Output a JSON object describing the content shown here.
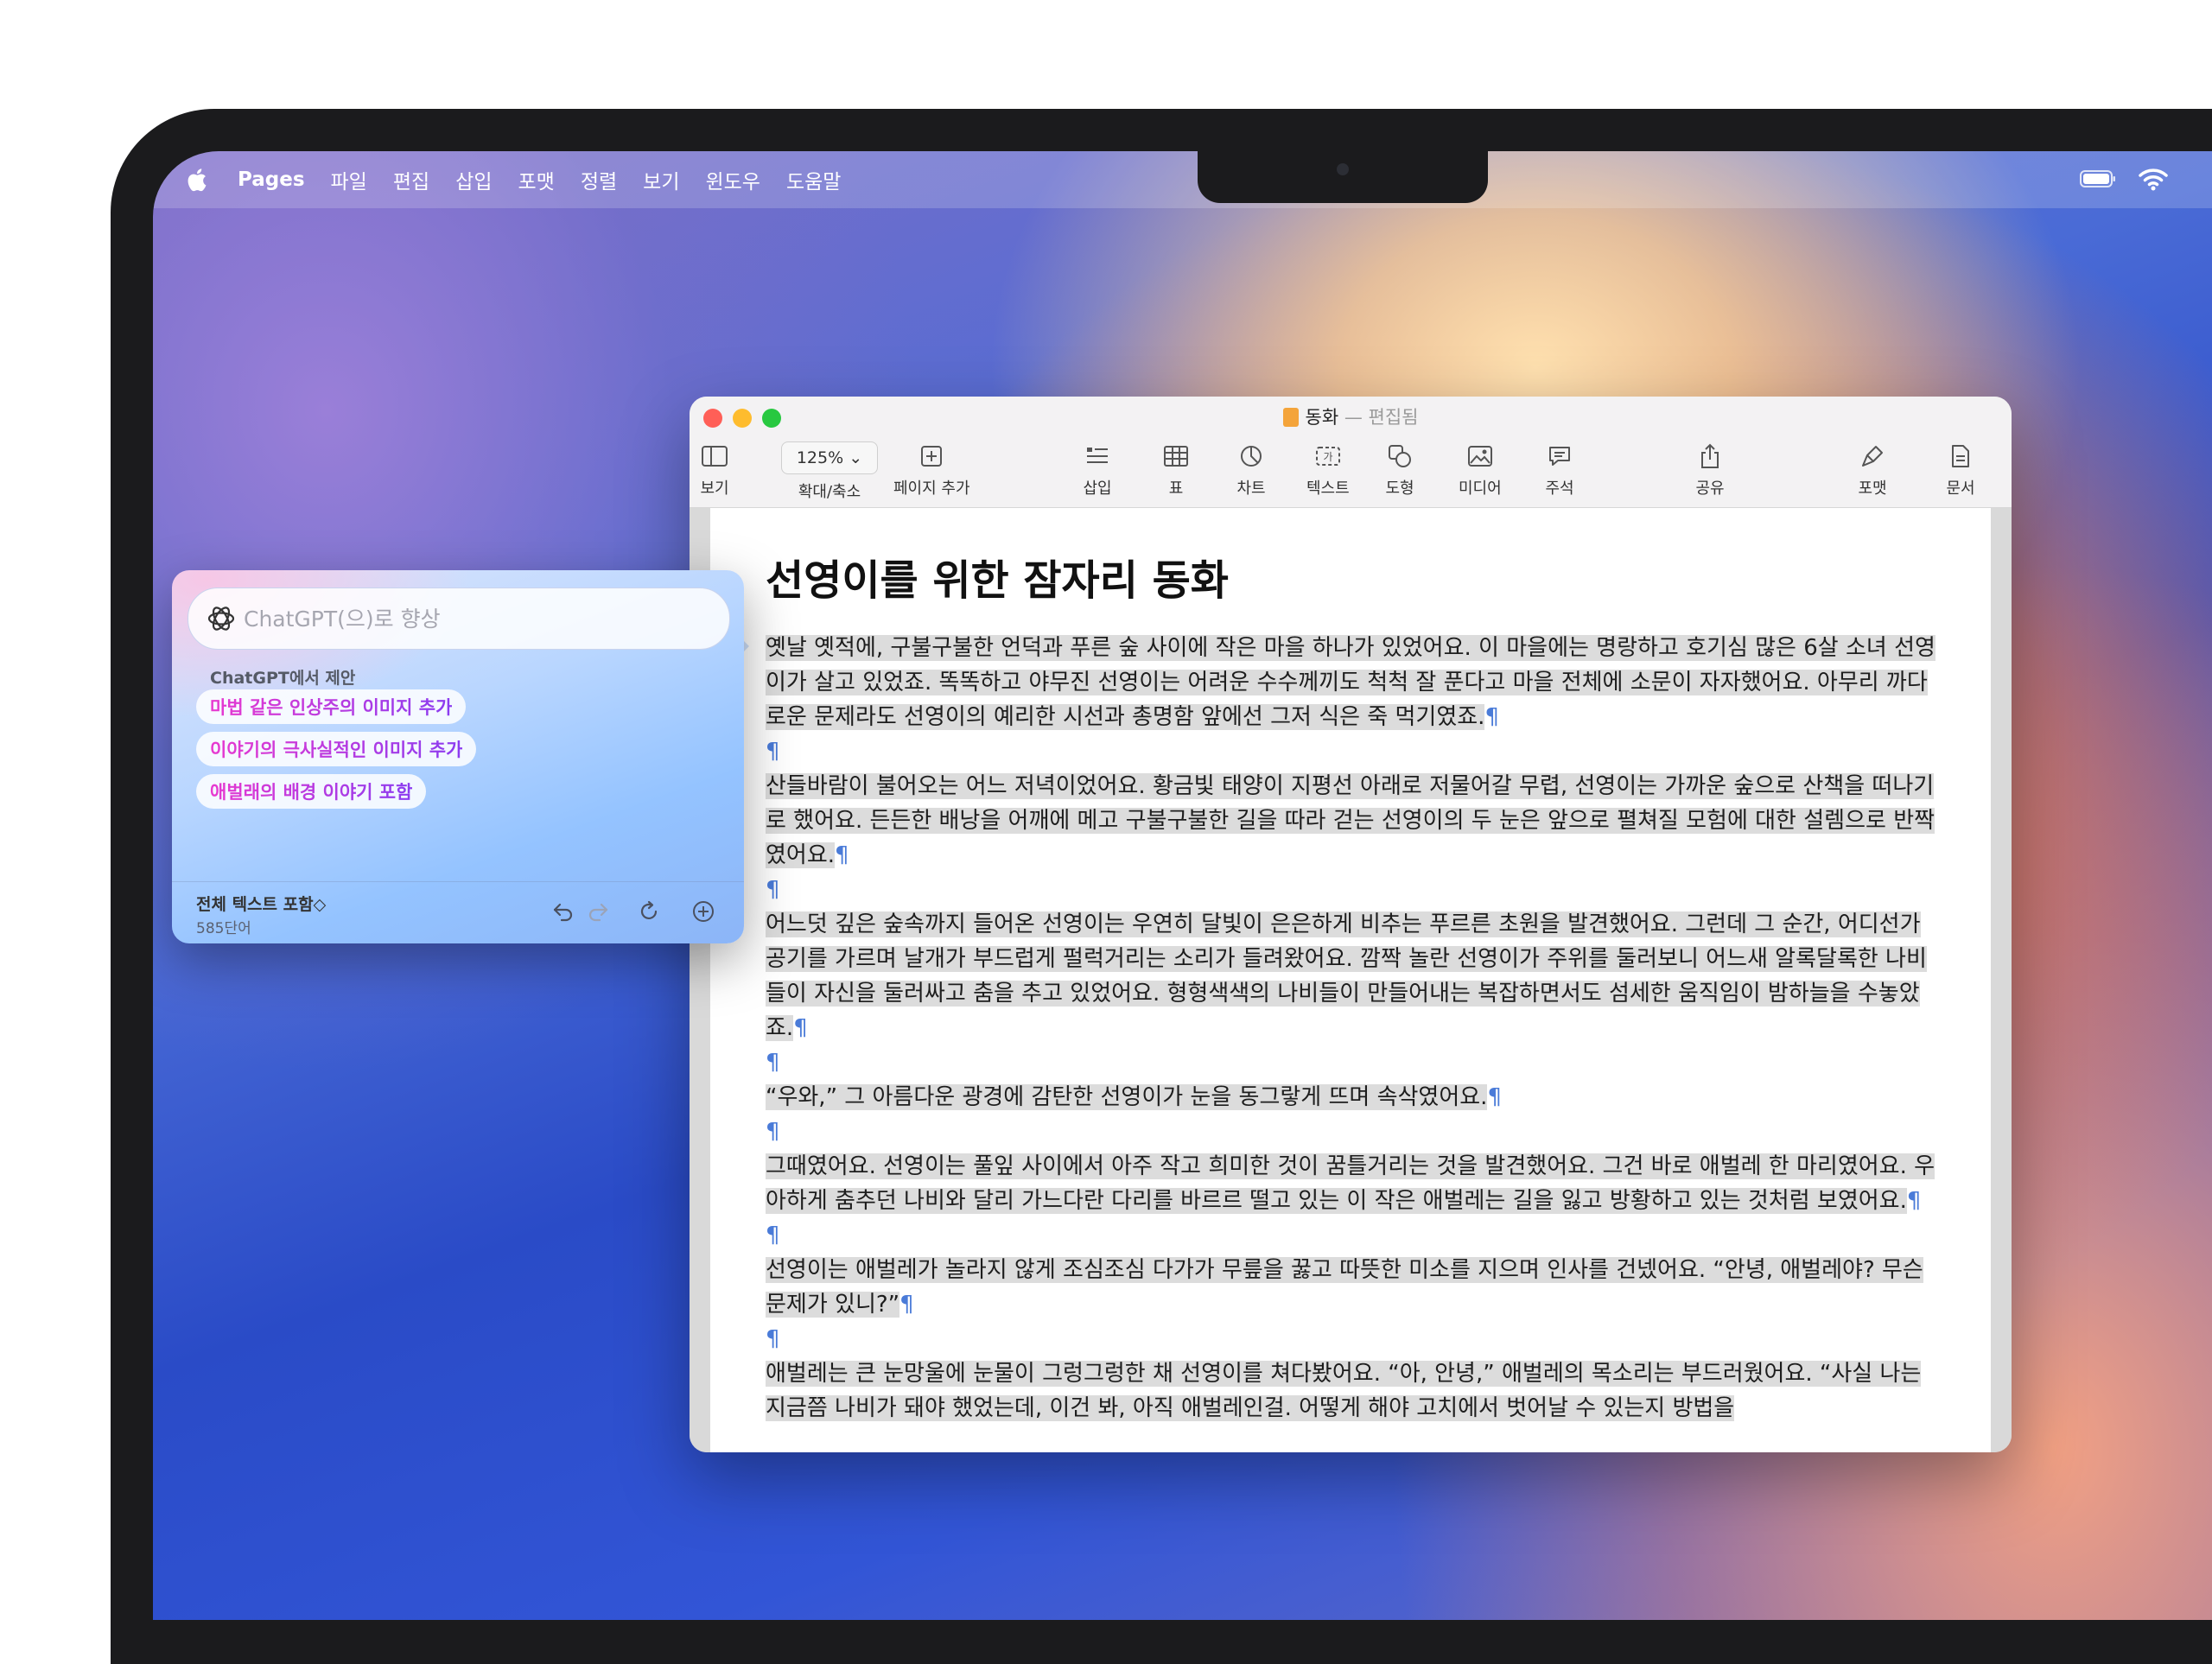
{
  "menubar": {
    "app_name": "Pages",
    "items": [
      "파일",
      "편집",
      "삽입",
      "포맷",
      "정렬",
      "보기",
      "윈도우",
      "도움말"
    ]
  },
  "window": {
    "doc_name": "동화",
    "separator": "—",
    "status": "편집됨",
    "zoom_value": "125%",
    "toolbar": {
      "view": "보기",
      "zoom": "확대/축소",
      "add_page": "페이지 추가",
      "insert": "삽입",
      "table": "표",
      "chart": "차트",
      "text": "텍스트",
      "shape": "도형",
      "media": "미디어",
      "comment": "주석",
      "share": "공유",
      "format": "포맷",
      "document": "문서"
    }
  },
  "document": {
    "title": "선영이를 위한 잠자리 동화",
    "pilcrow": "¶",
    "paragraphs": [
      "옛날 옛적에, 구불구불한 언덕과 푸른 숲 사이에 작은 마을 하나가 있었어요. 이 마을에는 명랑하고 호기심 많은 6살 소녀 선영이가 살고 있었죠. 똑똑하고 야무진 선영이는 어려운 수수께끼도 척척 잘 푼다고 마을 전체에 소문이 자자했어요. 아무리 까다로운 문제라도 선영이의 예리한 시선과 총명함 앞에선 그저 식은 죽 먹기였죠.",
      "산들바람이 불어오는 어느 저녁이었어요. 황금빛 태양이 지평선 아래로 저물어갈 무렵, 선영이는 가까운 숲으로 산책을 떠나기로 했어요. 든든한 배낭을 어깨에 메고 구불구불한 길을 따라 걷는 선영이의 두 눈은 앞으로 펼쳐질 모험에 대한 설렘으로 반짝였어요.",
      "어느덧 깊은 숲속까지 들어온 선영이는 우연히 달빛이 은은하게 비추는 푸르른 초원을 발견했어요. 그런데 그 순간, 어디선가 공기를 가르며 날개가 부드럽게 펄럭거리는 소리가 들려왔어요. 깜짝 놀란 선영이가 주위를 둘러보니 어느새 알록달록한 나비들이 자신을 둘러싸고 춤을 추고 있었어요. 형형색색의 나비들이 만들어내는 복잡하면서도 섬세한 움직임이 밤하늘을 수놓았죠.",
      " “우와,” 그 아름다운 광경에 감탄한 선영이가 눈을 동그랗게 뜨며 속삭였어요.",
      "그때였어요. 선영이는 풀잎 사이에서 아주 작고 희미한 것이 꿈틀거리는 것을 발견했어요. 그건 바로 애벌레 한 마리였어요. 우아하게 춤추던 나비와 달리 가느다란 다리를 바르르 떨고 있는 이 작은 애벌레는 길을 잃고 방황하고 있는 것처럼 보였어요.",
      "선영이는 애벌레가 놀라지 않게 조심조심 다가가 무릎을 꿇고 따뜻한 미소를 지으며 인사를 건넸어요. “안녕, 애벌레야? 무슨 문제가 있니?”",
      "애벌레는 큰 눈망울에 눈물이 그렁그렁한 채 선영이를 쳐다봤어요. “아, 안녕,” 애벌레의 목소리는 부드러웠어요. “사실 나는 지금쯤 나비가 돼야 했었는데, 이건 봐, 아직 애벌레인걸. 어떻게 해야 고치에서 벗어날 수 있는지 방법을"
    ]
  },
  "writing_panel": {
    "input_value": "",
    "placeholder": "ChatGPT(으)로 향상",
    "suggestions_label": "ChatGPT에서 제안",
    "suggestions": [
      "마법 같은 인상주의 이미지 추가",
      "이야기의 극사실적인 이미지 추가",
      "애벌래의 배경 이야기 포함"
    ],
    "footer_title": "전체 텍스트 포함◇",
    "word_count": "585단어"
  }
}
